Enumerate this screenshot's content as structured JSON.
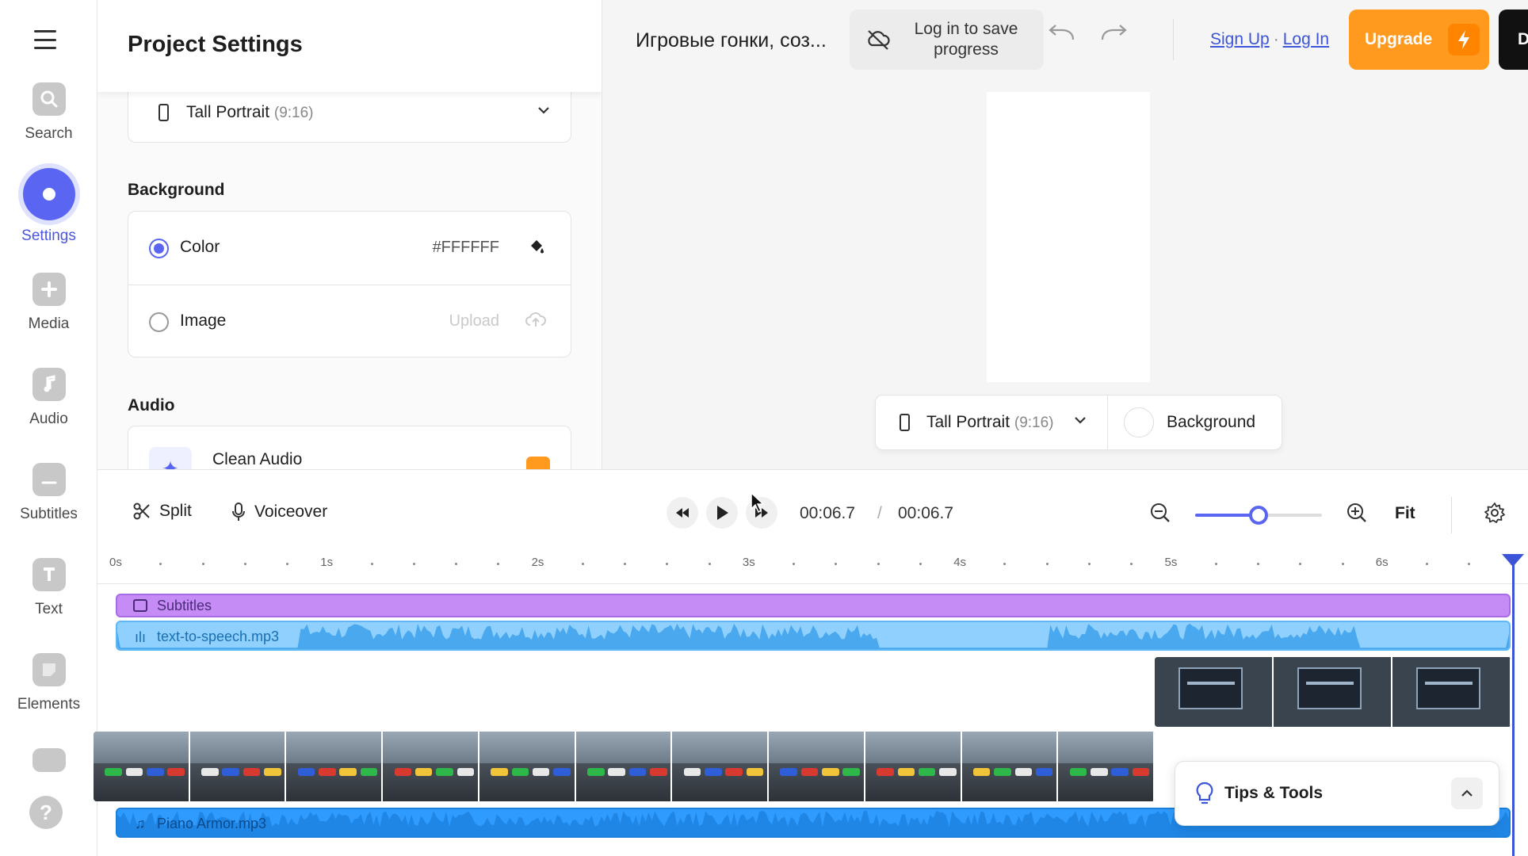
{
  "sidebar": {
    "items": [
      {
        "label": "Search",
        "icon": "search-icon"
      },
      {
        "label": "Settings",
        "icon": "settings-icon"
      },
      {
        "label": "Media",
        "icon": "plus-icon"
      },
      {
        "label": "Audio",
        "icon": "music-note-icon"
      },
      {
        "label": "Subtitles",
        "icon": "subtitles-icon"
      },
      {
        "label": "Text",
        "icon": "text-icon"
      },
      {
        "label": "Elements",
        "icon": "elements-icon"
      }
    ],
    "help_label": "?"
  },
  "panel": {
    "title": "Project Settings",
    "aspect": {
      "label": "Tall Portrait",
      "ratio": "(9:16)"
    },
    "background": {
      "title": "Background",
      "options": [
        {
          "label": "Color",
          "value": "#FFFFFF",
          "selected": true
        },
        {
          "label": "Image",
          "value": "Upload",
          "selected": false
        }
      ]
    },
    "audio": {
      "title": "Audio",
      "clean_audio_label": "Clean Audio"
    }
  },
  "topbar": {
    "project_name": "Игровые гонки, соз...",
    "save_label": "Log in to save progress",
    "signup_label": "Sign Up",
    "separator": "·",
    "login_label": "Log In",
    "upgrade_label": "Upgrade",
    "dark_button_label": "D"
  },
  "canvas_bar": {
    "aspect_label": "Tall Portrait",
    "aspect_ratio": "(9:16)",
    "background_label": "Background"
  },
  "timeline": {
    "split_label": "Split",
    "voiceover_label": "Voiceover",
    "current_time": "00:06.7",
    "time_separator": "/",
    "total_time": "00:06.7",
    "zoom_level": 0.5,
    "fit_label": "Fit",
    "ruler_ticks": [
      "0s",
      "1s",
      "2s",
      "3s",
      "4s",
      "5s",
      "6s"
    ],
    "tracks": {
      "subtitles_label": "Subtitles",
      "tts_label": "text-to-speech.mp3",
      "music_label": "Piano Armor.mp3"
    }
  },
  "tips": {
    "label": "Tips & Tools"
  },
  "colors": {
    "accent": "#5a66f2",
    "upgrade": "#ff9a1f",
    "link": "#3c55d8",
    "subtitle_track": "#c58cf5",
    "tts_track": "#8fd0ff",
    "music_track": "#2f9bff"
  }
}
